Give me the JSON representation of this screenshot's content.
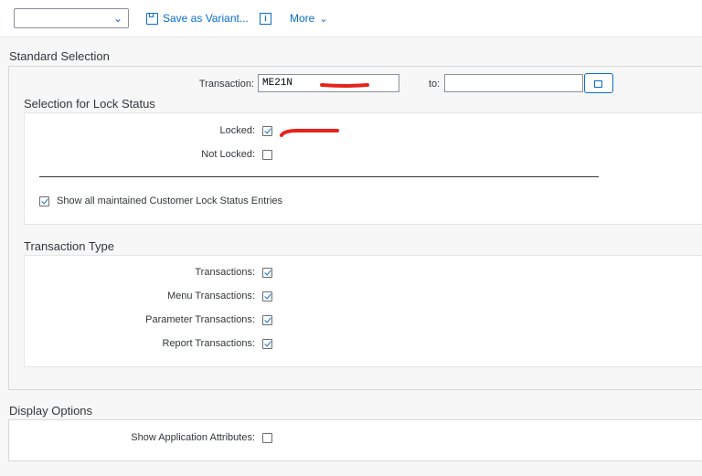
{
  "toolbar": {
    "variant_value": "",
    "save_variant_label": "Save as Variant...",
    "more_label": "More",
    "icons": [
      "chevron-down-icon",
      "save-icon",
      "info-icon",
      "chevron-down-icon"
    ]
  },
  "standard_selection": {
    "title": "Standard Selection",
    "transaction_label": "Transaction:",
    "transaction_value": "ME21N",
    "to_label": "to:",
    "to_value": ""
  },
  "lock_status": {
    "title": "Selection for Lock Status",
    "locked_label": "Locked:",
    "locked_checked": true,
    "not_locked_label": "Not Locked:",
    "not_locked_checked": false,
    "show_all_label": "Show all maintained Customer Lock Status Entries",
    "show_all_checked": true
  },
  "transaction_type": {
    "title": "Transaction Type",
    "items": [
      {
        "label": "Transactions:",
        "checked": true
      },
      {
        "label": "Menu Transactions:",
        "checked": true
      },
      {
        "label": "Parameter Transactions:",
        "checked": true
      },
      {
        "label": "Report Transactions:",
        "checked": true
      }
    ]
  },
  "display_options": {
    "title": "Display Options",
    "show_app_attr_label": "Show Application Attributes:",
    "show_app_attr_checked": false
  },
  "colors": {
    "accent": "#0a6ed1",
    "annotation": "#e5231b"
  }
}
